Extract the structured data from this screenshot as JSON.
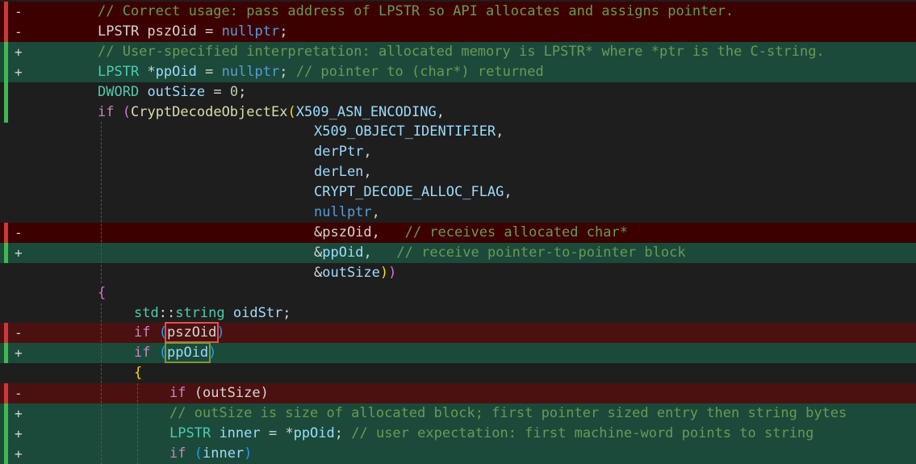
{
  "diff_view": {
    "lines": [
      {
        "kind": "del",
        "marker": "-",
        "indent": 0,
        "tokens": [
          {
            "t": "// Correct usage: pass address of LPSTR so API allocates and assigns pointer.",
            "c": "cmt"
          }
        ]
      },
      {
        "kind": "del",
        "marker": "-",
        "indent": 0,
        "tokens": [
          {
            "t": "LPSTR ",
            "c": "txt"
          },
          {
            "t": "pszOid",
            "c": "txt"
          },
          {
            "t": " = ",
            "c": "txt"
          },
          {
            "t": "nullptr",
            "c": "kw"
          },
          {
            "t": ";",
            "c": "txt"
          }
        ]
      },
      {
        "kind": "add",
        "marker": "+",
        "indent": 0,
        "tokens": [
          {
            "t": "// User-specified interpretation: allocated memory is LPSTR* where *ptr is the C-string.",
            "c": "cmt"
          }
        ]
      },
      {
        "kind": "add",
        "marker": "+",
        "indent": 0,
        "tokens": [
          {
            "t": "LPSTR",
            "c": "type"
          },
          {
            "t": " *",
            "c": "txt"
          },
          {
            "t": "ppOid",
            "c": "var"
          },
          {
            "t": " = ",
            "c": "txt"
          },
          {
            "t": "nullptr",
            "c": "kw"
          },
          {
            "t": "; ",
            "c": "txt"
          },
          {
            "t": "// pointer to (char*) returned",
            "c": "cmt"
          }
        ]
      },
      {
        "kind": "mod",
        "marker": "",
        "indent": 0,
        "tokens": [
          {
            "t": "DWORD",
            "c": "type"
          },
          {
            "t": " ",
            "c": "txt"
          },
          {
            "t": "outSize",
            "c": "var"
          },
          {
            "t": " = ",
            "c": "txt"
          },
          {
            "t": "0",
            "c": "num"
          },
          {
            "t": ";",
            "c": "txt"
          }
        ]
      },
      {
        "kind": "mod",
        "marker": "",
        "indent": 0,
        "tokens": [
          {
            "t": "if",
            "c": "ctrl"
          },
          {
            "t": " ",
            "c": "txt"
          },
          {
            "t": "(",
            "c": "p2"
          },
          {
            "t": "CryptDecodeObjectEx",
            "c": "fn"
          },
          {
            "t": "(",
            "c": "p1"
          },
          {
            "t": "X509_ASN_ENCODING",
            "c": "var"
          },
          {
            "t": ",",
            "c": "txt"
          }
        ]
      },
      {
        "kind": "ctx",
        "marker": "",
        "indent": 1,
        "tokens": [
          {
            "t": "X509_OBJECT_IDENTIFIER",
            "c": "var"
          },
          {
            "t": ",",
            "c": "txt"
          }
        ]
      },
      {
        "kind": "ctx",
        "marker": "",
        "indent": 1,
        "tokens": [
          {
            "t": "derPtr",
            "c": "var"
          },
          {
            "t": ",",
            "c": "txt"
          }
        ]
      },
      {
        "kind": "ctx",
        "marker": "",
        "indent": 1,
        "tokens": [
          {
            "t": "derLen",
            "c": "var"
          },
          {
            "t": ",",
            "c": "txt"
          }
        ]
      },
      {
        "kind": "ctx",
        "marker": "",
        "indent": 1,
        "tokens": [
          {
            "t": "CRYPT_DECODE_ALLOC_FLAG",
            "c": "var"
          },
          {
            "t": ",",
            "c": "txt"
          }
        ]
      },
      {
        "kind": "ctx",
        "marker": "",
        "indent": 1,
        "tokens": [
          {
            "t": "nullptr",
            "c": "kw"
          },
          {
            "t": ",",
            "c": "txt"
          }
        ]
      },
      {
        "kind": "del",
        "marker": "-",
        "indent": 1,
        "tokens": [
          {
            "t": "&pszOid,   ",
            "c": "txt"
          },
          {
            "t": "// receives allocated char*",
            "c": "cmt"
          }
        ]
      },
      {
        "kind": "add",
        "marker": "+",
        "indent": 1,
        "tokens": [
          {
            "t": "&",
            "c": "txt"
          },
          {
            "t": "ppOid",
            "c": "var"
          },
          {
            "t": ",   ",
            "c": "txt"
          },
          {
            "t": "// receive pointer-to-pointer block",
            "c": "cmt"
          }
        ]
      },
      {
        "kind": "ctx",
        "marker": "",
        "indent": 1,
        "tokens": [
          {
            "t": "&",
            "c": "txt"
          },
          {
            "t": "outSize",
            "c": "var"
          },
          {
            "t": ")",
            "c": "p1"
          },
          {
            "t": ")",
            "c": "p2"
          }
        ]
      },
      {
        "kind": "ctx",
        "marker": "",
        "indent": 0,
        "tokens": [
          {
            "t": "{",
            "c": "p2"
          }
        ]
      },
      {
        "kind": "ctx",
        "marker": "",
        "indent": 2,
        "tokens": [
          {
            "t": "std",
            "c": "type"
          },
          {
            "t": "::",
            "c": "txt"
          },
          {
            "t": "string",
            "c": "type"
          },
          {
            "t": " ",
            "c": "txt"
          },
          {
            "t": "oidStr",
            "c": "var"
          },
          {
            "t": ";",
            "c": "txt"
          }
        ]
      },
      {
        "kind": "del",
        "marker": "-",
        "indent": 2,
        "tokens": [
          {
            "t": "if",
            "c": "ctrl"
          },
          {
            "t": " ",
            "c": "txt"
          },
          {
            "t": "(",
            "c": "p3"
          },
          {
            "t": "pszOid",
            "c": "txt",
            "hl": "red"
          },
          {
            "t": ")",
            "c": "p3"
          }
        ]
      },
      {
        "kind": "add",
        "marker": "+",
        "indent": 2,
        "tokens": [
          {
            "t": "if",
            "c": "ctrl"
          },
          {
            "t": " ",
            "c": "txt"
          },
          {
            "t": "(",
            "c": "p3"
          },
          {
            "t": "ppOid",
            "c": "var",
            "hl": "green"
          },
          {
            "t": ")",
            "c": "p3"
          }
        ]
      },
      {
        "kind": "ctx",
        "marker": "",
        "indent": 2,
        "tokens": [
          {
            "t": "{",
            "c": "p1"
          }
        ]
      },
      {
        "kind": "del",
        "marker": "-",
        "indent": 3,
        "tokens": [
          {
            "t": "if",
            "c": "ctrl"
          },
          {
            "t": " (outSize)",
            "c": "txt"
          }
        ]
      },
      {
        "kind": "add",
        "marker": "+",
        "indent": 3,
        "tokens": [
          {
            "t": "// outSize is size of allocated block; first pointer sized entry then string bytes",
            "c": "cmt"
          }
        ]
      },
      {
        "kind": "add",
        "marker": "+",
        "indent": 3,
        "tokens": [
          {
            "t": "LPSTR",
            "c": "type"
          },
          {
            "t": " ",
            "c": "txt"
          },
          {
            "t": "inner",
            "c": "var"
          },
          {
            "t": " = *",
            "c": "txt"
          },
          {
            "t": "ppOid",
            "c": "var"
          },
          {
            "t": "; ",
            "c": "txt"
          },
          {
            "t": "// user expectation: first machine-word points to string",
            "c": "cmt"
          }
        ]
      },
      {
        "kind": "add",
        "marker": "+",
        "indent": 3,
        "tokens": [
          {
            "t": "if",
            "c": "ctrl"
          },
          {
            "t": " ",
            "c": "txt"
          },
          {
            "t": "(",
            "c": "p3"
          },
          {
            "t": "inner",
            "c": "var"
          },
          {
            "t": ")",
            "c": "p3"
          }
        ]
      }
    ]
  }
}
